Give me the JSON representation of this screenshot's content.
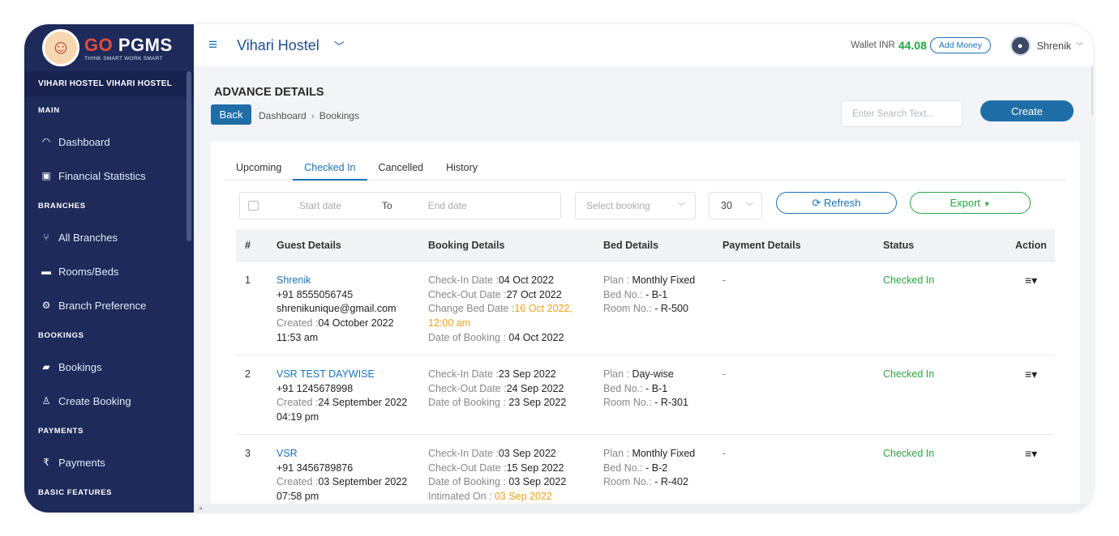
{
  "logo": {
    "brand_go": "GO",
    "brand_rest": " PGMS",
    "tagline": "THINK SMART WORK SMART"
  },
  "sidebar": {
    "hostel": "VIHARI HOSTEL VIHARI HOSTEL",
    "sections": [
      {
        "title": "MAIN",
        "items": [
          {
            "label": "Dashboard",
            "icon": "dashboard-icon"
          },
          {
            "label": "Financial Statistics",
            "icon": "money-icon"
          }
        ]
      },
      {
        "title": "BRANCHES",
        "items": [
          {
            "label": "All Branches",
            "icon": "branch-icon"
          },
          {
            "label": "Rooms/Beds",
            "icon": "bed-icon"
          },
          {
            "label": "Branch Preference",
            "icon": "gears-icon"
          }
        ]
      },
      {
        "title": "BOOKINGS",
        "items": [
          {
            "label": "Bookings",
            "icon": "book-icon"
          },
          {
            "label": "Create Booking",
            "icon": "user-icon"
          }
        ]
      },
      {
        "title": "PAYMENTS",
        "items": [
          {
            "label": "Payments",
            "icon": "rupee-icon"
          }
        ]
      },
      {
        "title": "BASIC FEATURES",
        "items": []
      }
    ]
  },
  "topbar": {
    "hostel": "Vihari Hostel",
    "wallet_label": "Wallet INR",
    "wallet_amount": "44.08",
    "add_money": "Add Money",
    "user": "Shrenik"
  },
  "page": {
    "heading": "ADVANCE DETAILS",
    "back": "Back",
    "breadcrumb_home": "Dashboard",
    "breadcrumb_current": "Bookings",
    "search_placeholder": "Enter Search Text...",
    "create": "Create"
  },
  "tabs": [
    "Upcoming",
    "Checked In",
    "Cancelled",
    "History"
  ],
  "active_tab": "Checked In",
  "filters": {
    "start_date": "Start date",
    "to": "To",
    "end_date": "End date",
    "select_booking": "Select booking",
    "page_size": "30",
    "refresh": "Refresh",
    "export": "Export"
  },
  "table": {
    "headers": [
      "#",
      "Guest Details",
      "Booking Details",
      "Bed Details",
      "Payment Details",
      "Status",
      "Action"
    ],
    "rows": [
      {
        "num": "1",
        "name": "Shrenik",
        "phone": "+91 8555056745",
        "email": "shrenikunique@gmail.com",
        "created_label": "Created :",
        "created": "04 October 2022",
        "created_time": "11:53 am",
        "checkin_label": "Check-In Date :",
        "checkin": "04 Oct 2022",
        "checkout_label": "Check-Out Date :",
        "checkout": "27 Oct 2022",
        "change_label": "Change Bed Date :",
        "change": "16 Oct 2022,",
        "change_time": "12:00 am",
        "dob_label": "Date of Booking : ",
        "dob": "04 Oct 2022",
        "plan_label": "Plan : ",
        "plan": "Monthly Fixed",
        "bed_label": "Bed No.: ",
        "bed": "- B-1",
        "room_label": "Room No.: ",
        "room": "- R-500",
        "payment": "-",
        "status": "Checked In"
      },
      {
        "num": "2",
        "name": "VSR TEST DAYWISE",
        "phone": "+91 1245678998",
        "created_label": "Created :",
        "created": "24 September 2022",
        "created_time": "04:19 pm",
        "checkin_label": "Check-In Date :",
        "checkin": "23 Sep 2022",
        "checkout_label": "Check-Out Date :",
        "checkout": "24 Sep 2022",
        "dob_label": "Date of Booking : ",
        "dob": "23 Sep 2022",
        "plan_label": "Plan : ",
        "plan": "Day-wise",
        "bed_label": "Bed No.: ",
        "bed": "- B-1",
        "room_label": "Room No.: ",
        "room": "- R-301",
        "payment": "-",
        "status": "Checked In"
      },
      {
        "num": "3",
        "name": "VSR",
        "phone": "+91 3456789876",
        "created_label": "Created :",
        "created": "03 September 2022",
        "created_time": "07:58 pm",
        "checkin_label": "Check-In Date :",
        "checkin": "03 Sep 2022",
        "checkout_label": "Check-Out Date :",
        "checkout": "15 Sep 2022",
        "dob_label": "Date of Booking : ",
        "dob": "03 Sep 2022",
        "intimated_label": "Intimated On : ",
        "intimated": "03 Sep 2022",
        "plan_label": "Plan : ",
        "plan": "Monthly Fixed",
        "bed_label": "Bed No.: ",
        "bed": "- B-2",
        "room_label": "Room No.: ",
        "room": "- R-402",
        "payment": "-",
        "status": "Checked In"
      }
    ]
  },
  "colors": {
    "sidebar": "#1d2a5a",
    "primary": "#1f6ea8",
    "success": "#27a744",
    "warning": "#f0a01a"
  }
}
